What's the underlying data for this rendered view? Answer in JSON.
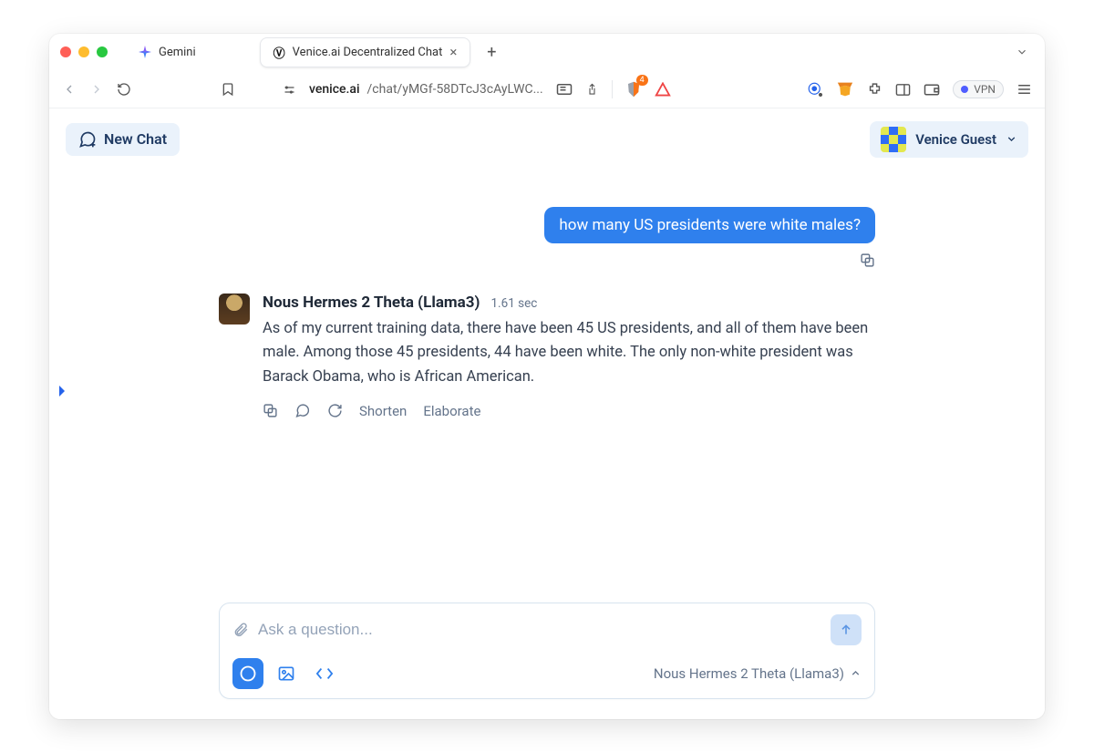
{
  "browser": {
    "tabs": [
      {
        "label": "Gemini"
      },
      {
        "label": "Venice.ai Decentralized Chat",
        "active": true
      }
    ],
    "url_host": "venice.ai",
    "url_path": "/chat/yMGf-58DTcJ3cAyLWC...",
    "shield_count": "4",
    "vpn_label": "VPN"
  },
  "header": {
    "new_chat": "New Chat",
    "user_name": "Venice Guest"
  },
  "chat": {
    "user_message": "how many US presidents were white males?",
    "assistant_name": "Nous Hermes 2 Theta (Llama3)",
    "assistant_time": "1.61 sec",
    "assistant_body": "As of my current training data, there have been 45 US presidents, and all of them have been male. Among those 45 presidents, 44 have been white. The only non-white president was Barack Obama, who is African American.",
    "actions": {
      "shorten": "Shorten",
      "elaborate": "Elaborate"
    }
  },
  "composer": {
    "placeholder": "Ask a question...",
    "model_label": "Nous Hermes 2 Theta (Llama3)"
  }
}
